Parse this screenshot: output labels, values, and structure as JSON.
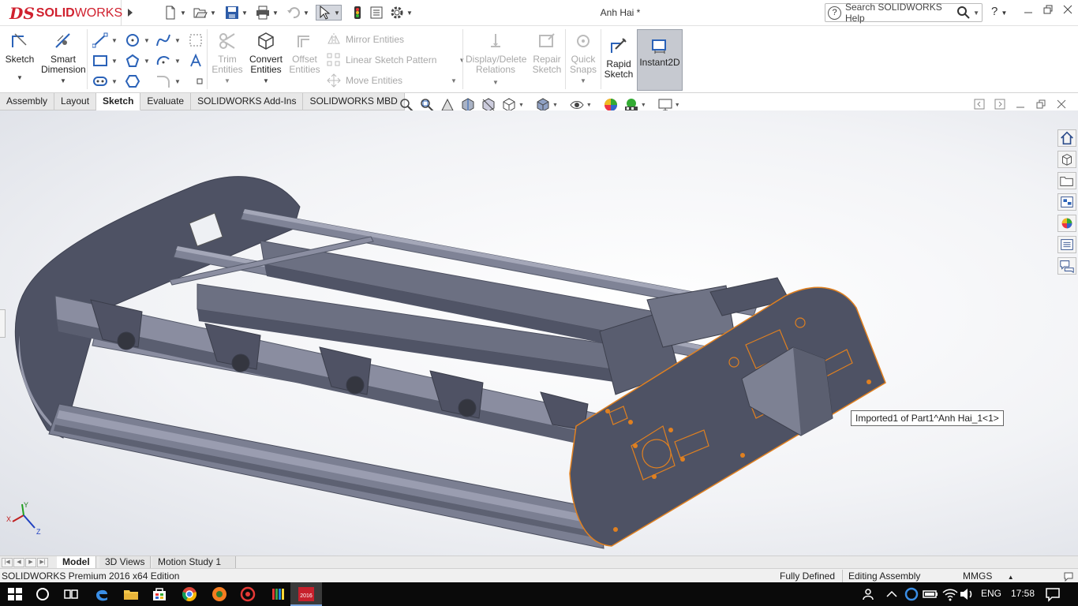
{
  "window": {
    "title": "Anh Hai *",
    "brand_ds": "DS",
    "brand_solid": "SOLID",
    "brand_works": "WORKS"
  },
  "search": {
    "label": "Search SOLIDWORKS Help"
  },
  "help": {
    "label": "?"
  },
  "ribbon": {
    "sketch": {
      "label": "Sketch"
    },
    "smart_dimension": {
      "line1": "Smart",
      "line2": "Dimension"
    },
    "trim_entities": {
      "line1": "Trim",
      "line2": "Entities"
    },
    "convert_entities": {
      "line1": "Convert",
      "line2": "Entities"
    },
    "offset_entities": {
      "line1": "Offset",
      "line2": "Entities"
    },
    "mirror_entities": {
      "label": "Mirror Entities"
    },
    "linear_sketch_pattern": {
      "label": "Linear Sketch Pattern"
    },
    "move_entities": {
      "label": "Move Entities"
    },
    "display_delete_relations": {
      "line1": "Display/Delete",
      "line2": "Relations"
    },
    "repair_sketch": {
      "line1": "Repair",
      "line2": "Sketch"
    },
    "quick_snaps": {
      "line1": "Quick",
      "line2": "Snaps"
    },
    "rapid_sketch": {
      "line1": "Rapid",
      "line2": "Sketch"
    },
    "instant2d": {
      "label": "Instant2D"
    }
  },
  "command_tabs": [
    {
      "label": "Assembly",
      "active": false
    },
    {
      "label": "Layout",
      "active": false
    },
    {
      "label": "Sketch",
      "active": true
    },
    {
      "label": "Evaluate",
      "active": false
    },
    {
      "label": "SOLIDWORKS Add-Ins",
      "active": false
    },
    {
      "label": "SOLIDWORKS MBD",
      "active": false
    }
  ],
  "graphics": {
    "tooltip": "Imported1 of Part1^Anh Hai_1<1>",
    "triad": {
      "x": "X",
      "y": "Y",
      "z": "Z"
    }
  },
  "bottom_tabs": [
    {
      "label": "Model",
      "active": true
    },
    {
      "label": "3D Views",
      "active": false
    },
    {
      "label": "Motion Study 1",
      "active": false
    }
  ],
  "status": {
    "edition": "SOLIDWORKS Premium 2016 x64 Edition",
    "definition": "Fully Defined",
    "mode": "Editing Assembly",
    "units": "MMGS"
  },
  "taskbar": {
    "language": "ENG",
    "time": "17:58"
  },
  "colors": {
    "brand_red": "#d0202e",
    "model_dark": "#5d6172",
    "model_mid": "#7c8092",
    "model_light": "#9a9db0",
    "highlight": "#e08020",
    "taskbar": "#0a0a0a"
  }
}
